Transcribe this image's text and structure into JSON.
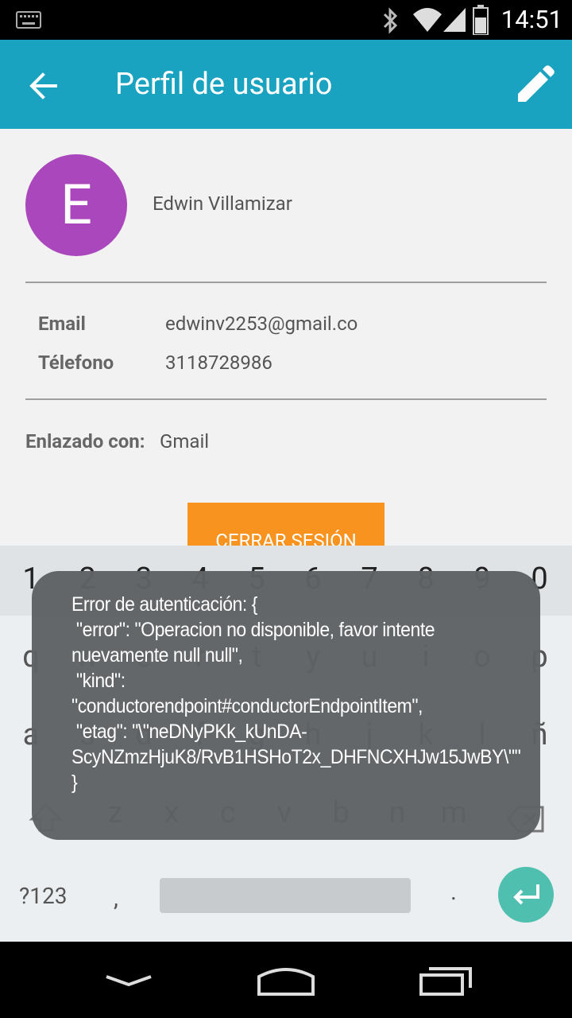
{
  "status_bar": {
    "time": "14:51",
    "icons": [
      "keyboard-icon",
      "bluetooth-icon",
      "wifi-icon",
      "signal-icon",
      "battery-icon"
    ]
  },
  "app_bar": {
    "title": "Perfil de usuario",
    "back_icon": "arrow-back-icon",
    "edit_icon": "edit-pencil-icon",
    "color": "#1aa3c1"
  },
  "profile": {
    "avatar_letter": "E",
    "avatar_color": "#ab47bc",
    "name": "Edwin Villamizar",
    "email_label": "Email",
    "email_value": "edwinv2253@gmail.co",
    "phone_label": "Télefono",
    "phone_value": "3118728986",
    "linked_label": "Enlazado con:",
    "linked_value": "Gmail",
    "logout_label": "CERRAR SESIÓN"
  },
  "keyboard": {
    "numbers": [
      "1",
      "2",
      "3",
      "4",
      "5",
      "6",
      "7",
      "8",
      "9",
      "0"
    ],
    "row1": [
      "q",
      "w",
      "e",
      "r",
      "t",
      "y",
      "u",
      "i",
      "o",
      "p"
    ],
    "row2": [
      "a",
      "s",
      "d",
      "f",
      "g",
      "h",
      "j",
      "k",
      "l",
      "ñ"
    ],
    "row3": [
      "z",
      "x",
      "c",
      "v",
      "b",
      "n",
      "m"
    ],
    "symbols_label": "?123",
    "comma": ",",
    "period": "."
  },
  "toast": {
    "message": "Error de autenticación: {\n \"error\": \"Operacion no disponible, favor intente nuevamente null null\",\n \"kind\": \"conductorendpoint#conductorEndpointItem\",\n \"etag\": \"\\\"neDNyPKk_kUnDA-ScyNZmzHjuK8/RvB1HSHoT2x_DHFNCXHJw15JwBY\\\"\"\n}"
  }
}
